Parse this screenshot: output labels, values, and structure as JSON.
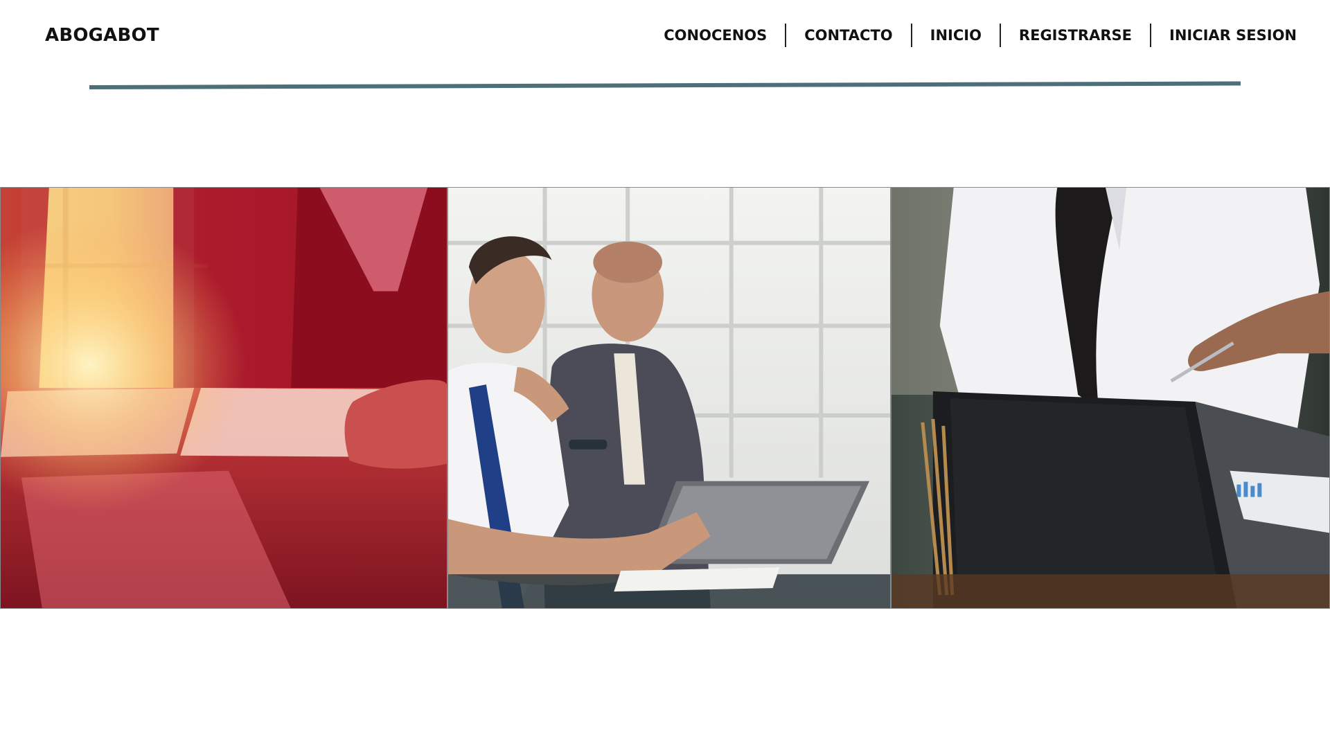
{
  "header": {
    "brand": "ABOGABOT",
    "nav": [
      {
        "label": "CONOCENOS"
      },
      {
        "label": "CONTACTO"
      },
      {
        "label": "INICIO"
      },
      {
        "label": "REGISTRARSE"
      },
      {
        "label": "INICIAR SESION"
      }
    ]
  },
  "colors": {
    "rule": "#4d6f78",
    "text": "#111111",
    "background": "#ffffff"
  },
  "gallery": {
    "images": [
      {
        "subject": "hands-signing-documents-red-warm-light"
      },
      {
        "subject": "two-businessmen-looking-at-tablet"
      },
      {
        "subject": "woman-at-laptop-with-colleague-pointing-pen"
      }
    ]
  }
}
